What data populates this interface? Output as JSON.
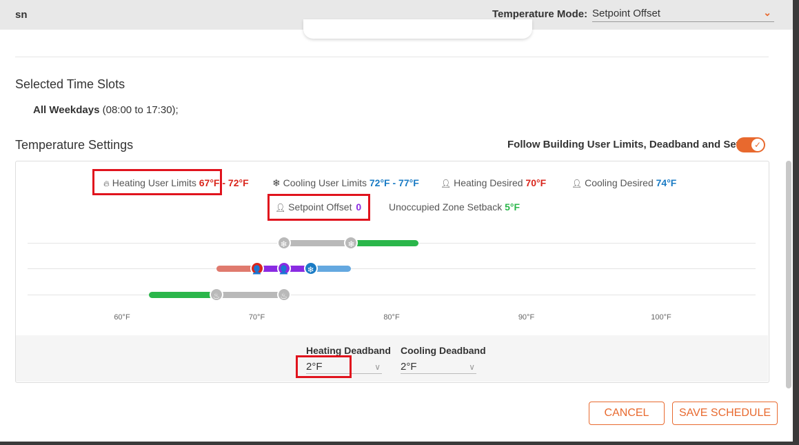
{
  "header": {
    "title": "sn",
    "mode_label": "Temperature Mode:",
    "mode_value": "Setpoint Offset"
  },
  "time_slots": {
    "heading": "Selected Time Slots",
    "day": "All Weekdays",
    "range": " (08:00 to 17:30);"
  },
  "temperature_settings": {
    "heading": "Temperature Settings",
    "follow_label": "Follow Building User Limits, Deadband and Setback",
    "follow_enabled": true
  },
  "legend": {
    "heating_limits": {
      "label": "Heating User Limits",
      "value": "67°F - 72°F"
    },
    "cooling_limits": {
      "label": "Cooling User Limits",
      "value": "72°F - 77°F"
    },
    "heating_desired": {
      "label": "Heating Desired",
      "value": "70°F"
    },
    "cooling_desired": {
      "label": "Cooling Desired",
      "value": "74°F"
    },
    "setpoint_offset": {
      "label": "Setpoint Offset",
      "value": "0"
    },
    "setback": {
      "label": "Unoccupied Zone Setback",
      "value": "5°F"
    }
  },
  "chart_data": {
    "type": "range-slider",
    "x_axis": {
      "min": 55,
      "max": 102,
      "ticks": [
        "60°F",
        "70°F",
        "80°F",
        "90°F",
        "100°F"
      ],
      "tick_values": [
        60,
        70,
        80,
        90,
        100
      ]
    },
    "cooling_row": {
      "limit_low": 72,
      "limit_high": 77,
      "setback_high": 82
    },
    "desired_row": {
      "heating_desired": 70,
      "setpoint": 72,
      "cooling_desired": 74,
      "heat_band_low": 67,
      "cool_band_high": 77
    },
    "heating_row": {
      "setback_low": 62,
      "limit_low": 67,
      "limit_high": 72
    }
  },
  "deadband": {
    "heating": {
      "label": "Heating Deadband",
      "value": "2°F"
    },
    "cooling": {
      "label": "Cooling Deadband",
      "value": "2°F"
    }
  },
  "buttons": {
    "cancel": "CANCEL",
    "save": "SAVE SCHEDULE"
  },
  "colors": {
    "accent": "#e8692e",
    "heating": "#d9261c",
    "cooling": "#1a7bc4",
    "offset": "#8a2be2",
    "setback": "#2ab64a"
  }
}
